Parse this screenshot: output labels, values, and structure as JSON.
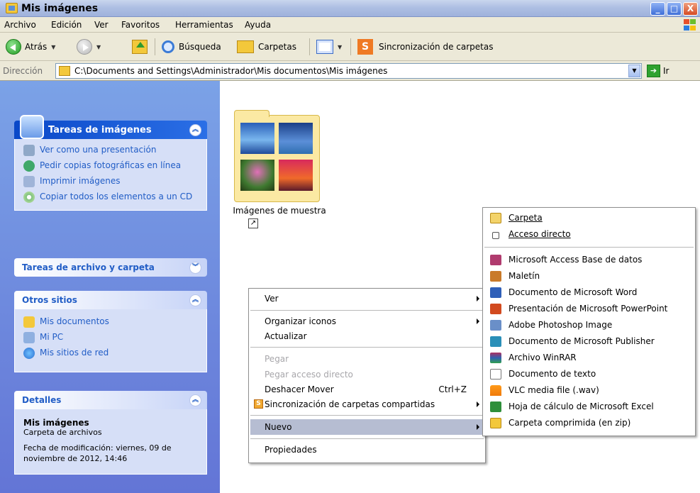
{
  "window": {
    "title": "Mis imágenes",
    "min": "_",
    "max": "□",
    "close": "X"
  },
  "menu": [
    "Archivo",
    "Edición",
    "Ver",
    "Favoritos",
    "Herramientas",
    "Ayuda"
  ],
  "toolbar": {
    "back": "Atrás",
    "search": "Búsqueda",
    "folders": "Carpetas",
    "sync": "Sincronización de carpetas"
  },
  "address": {
    "label": "Dirección",
    "path": "C:\\Documents and Settings\\Administrador\\Mis documentos\\Mis imágenes",
    "go": "Ir"
  },
  "taskpane": {
    "image_tasks": {
      "title": "Tareas de imágenes",
      "items": [
        "Ver como una presentación",
        "Pedir copias fotográficas en línea",
        "Imprimir imágenes",
        "Copiar todos los elementos a un CD"
      ]
    },
    "file_tasks": {
      "title": "Tareas de archivo y carpeta"
    },
    "other_places": {
      "title": "Otros sitios",
      "items": [
        "Mis documentos",
        "Mi PC",
        "Mis sitios de red"
      ]
    },
    "details": {
      "title": "Detalles",
      "name": "Mis imágenes",
      "type": "Carpeta de archivos",
      "modified": "Fecha de modificación: viernes, 09 de noviembre de 2012, 14:46"
    }
  },
  "files": [
    {
      "label": "Imágenes de muestra"
    }
  ],
  "context_menu": {
    "ver": "Ver",
    "organizar": "Organizar iconos",
    "actualizar": "Actualizar",
    "pegar": "Pegar",
    "pegar_acceso": "Pegar acceso directo",
    "deshacer": "Deshacer Mover",
    "deshacer_shortcut": "Ctrl+Z",
    "sincronizacion": "Sincronización de carpetas compartidas",
    "nuevo": "Nuevo",
    "propiedades": "Propiedades"
  },
  "submenu": {
    "carpeta": "Carpeta",
    "acceso": "Acceso directo",
    "items": [
      "Microsoft Access Base de datos",
      "Maletín",
      "Documento de Microsoft Word",
      "Presentación de Microsoft PowerPoint",
      "Adobe Photoshop Image",
      "Documento de Microsoft Publisher",
      "Archivo WinRAR",
      "Documento de texto",
      "VLC media file (.wav)",
      "Hoja de cálculo de Microsoft Excel",
      "Carpeta comprimida (en zip)"
    ]
  }
}
